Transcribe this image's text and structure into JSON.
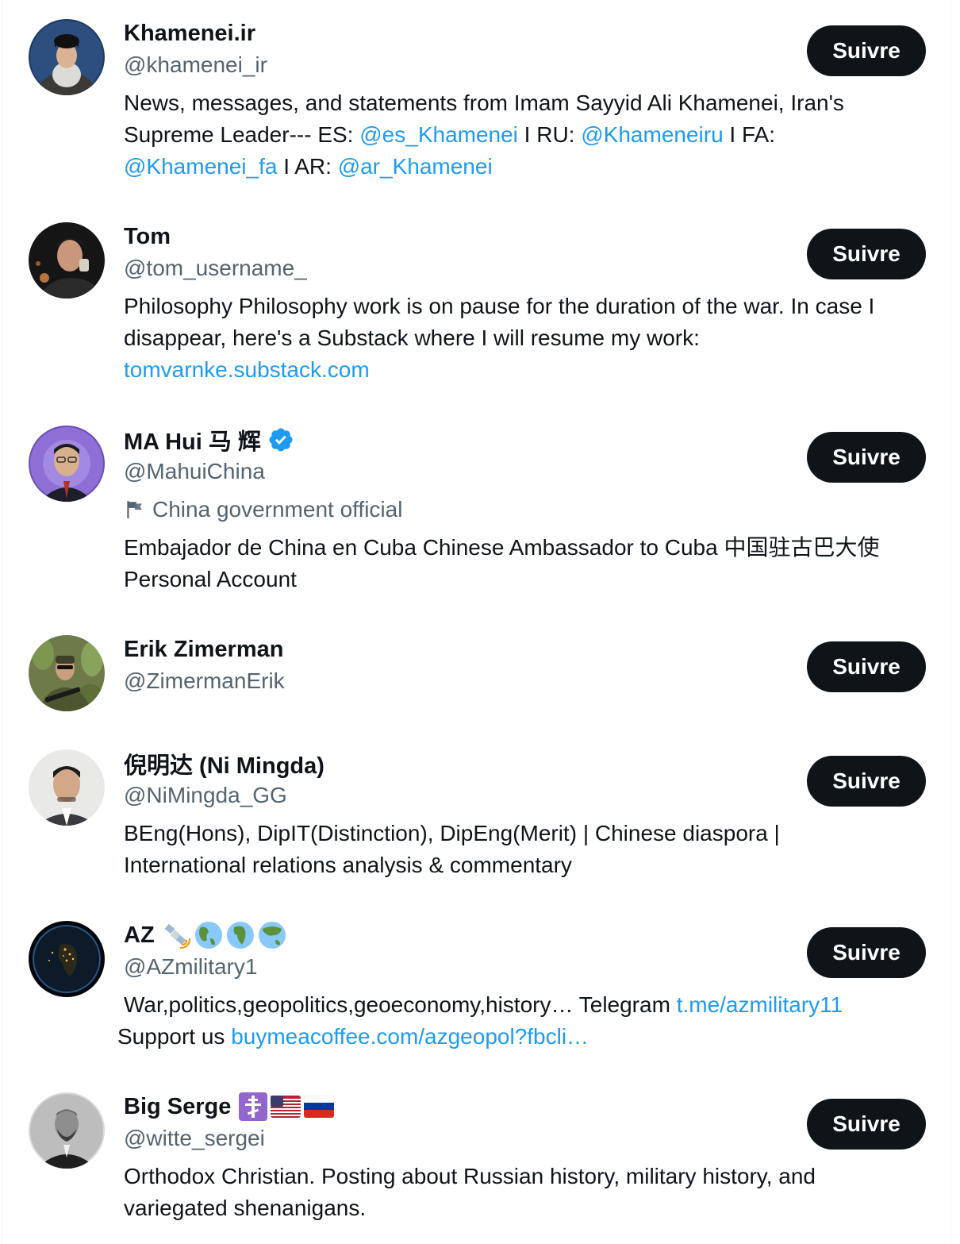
{
  "follow_label": "Suivre",
  "colors": {
    "text": "#0f1419",
    "secondary": "#536471",
    "link": "#1d9bf0",
    "button_bg": "#0f1419",
    "button_text": "#ffffff",
    "verified": "#1d9bf0"
  },
  "users": [
    {
      "name": "Khamenei.ir",
      "handle": "@khamenei_ir",
      "bio": {
        "t1": "News, messages, and statements from Imam Sayyid Ali Khamenei, Iran's Supreme Leader--- ES: ",
        "l1": "@es_Khamenei",
        "t2": " I RU: ",
        "l2": "@Khameneiru",
        "t3": " I FA: ",
        "l3": "@Khamenei_fa",
        "t4": " I AR: ",
        "l4": "@ar_Khamenei"
      }
    },
    {
      "name": "Tom",
      "handle": "@tom_username_",
      "bio": {
        "t1": "Philosophy Philosophy work is on pause for the duration of the war. In case I disappear, here's a Substack where I will resume my work: ",
        "l1": "tomvarnke.substack.com"
      }
    },
    {
      "name": "MA Hui 马 辉",
      "handle": "@MahuiChina",
      "verified": true,
      "label": "China government official",
      "label_icon": "flag-icon",
      "bio": {
        "t1": "Embajador de China en Cuba Chinese Ambassador to Cuba 中国驻古巴大使 Personal Account"
      }
    },
    {
      "name": "Erik Zimerman",
      "handle": "@ZimermanErik"
    },
    {
      "name": "倪明达 (Ni Mingda)",
      "handle": "@NiMingda_GG",
      "bio": {
        "t1": "BEng(Hons), DipIT(Distinction), DipEng(Merit) | Chinese diaspora | International relations analysis & commentary"
      }
    },
    {
      "name": "AZ",
      "name_emojis": [
        "satellite-icon",
        "globe-americas-icon",
        "globe-africa-icon",
        "globe-asia-icon"
      ],
      "handle": "@AZmilitary1",
      "bio": {
        "t1": "War,politics,geopolitics,geoeconomy,history… Telegram ",
        "l1": "t.me/azmilitary11",
        "t2": " Support us ",
        "l2": "buymeacoffee.com/azgeopol?fbcli…"
      }
    },
    {
      "name": "Big Serge",
      "name_emojis": [
        "orthodox-cross-icon",
        "us-flag-icon",
        "russia-flag-icon"
      ],
      "handle": "@witte_sergei",
      "bio": {
        "t1": "Orthodox Christian. Posting about Russian history, military history, and variegated shenanigans."
      }
    }
  ]
}
